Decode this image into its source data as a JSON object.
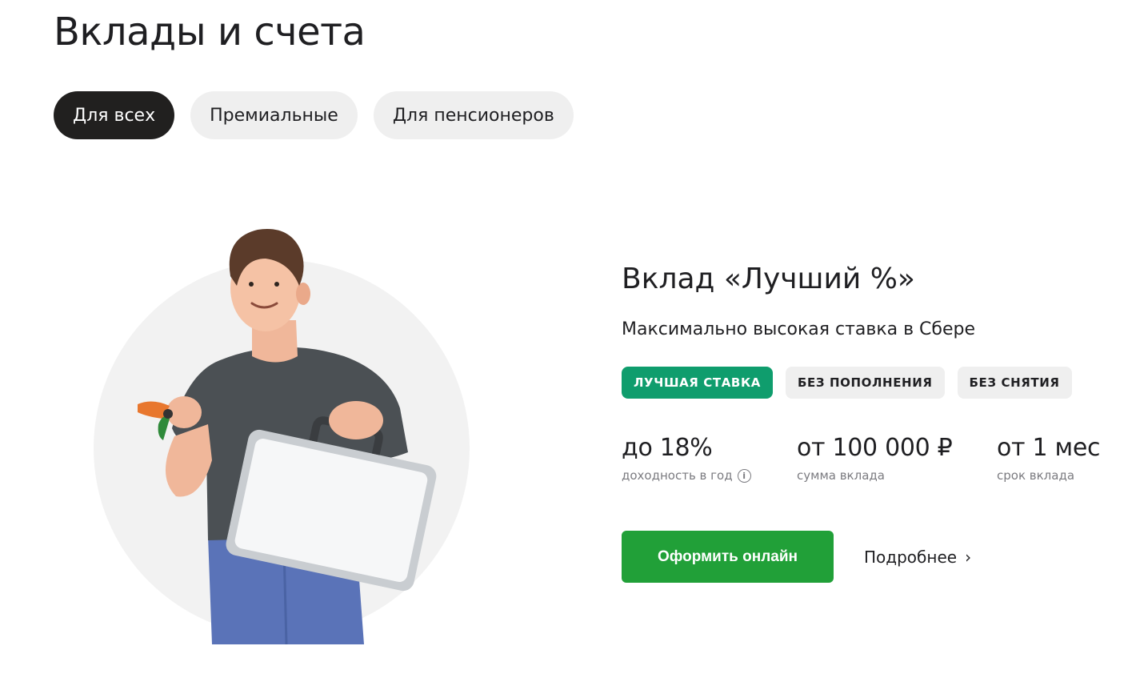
{
  "page": {
    "title": "Вклады и счета"
  },
  "tabs": [
    {
      "label": "Для всех",
      "active": true
    },
    {
      "label": "Премиальные",
      "active": false
    },
    {
      "label": "Для пенсионеров",
      "active": false
    }
  ],
  "product": {
    "title": "Вклад «Лучший %»",
    "subtitle": "Максимально высокая ставка в Сбере",
    "badges": [
      {
        "label": "ЛУЧШАЯ СТАВКА",
        "accent": true
      },
      {
        "label": "БЕЗ ПОПОЛНЕНИЯ",
        "accent": false
      },
      {
        "label": "БЕЗ СНЯТИЯ",
        "accent": false
      }
    ],
    "stats": [
      {
        "value": "до 18%",
        "label": "доходность в год",
        "info_icon": "info-icon"
      },
      {
        "value": "от 100 000 ₽",
        "label": "сумма вклада"
      },
      {
        "value": "от 1 мес",
        "label": "срок вклада"
      }
    ],
    "primary_button": "Оформить онлайн",
    "more_link": "Подробнее",
    "more_icon": "chevron-right-icon"
  },
  "illustration": {
    "icon": "person-with-briefcase-illustration"
  },
  "colors": {
    "accent_green": "#21a038",
    "badge_green": "#0f9d6d",
    "active_tab": "#21201f",
    "inactive_tab": "#efefef"
  }
}
